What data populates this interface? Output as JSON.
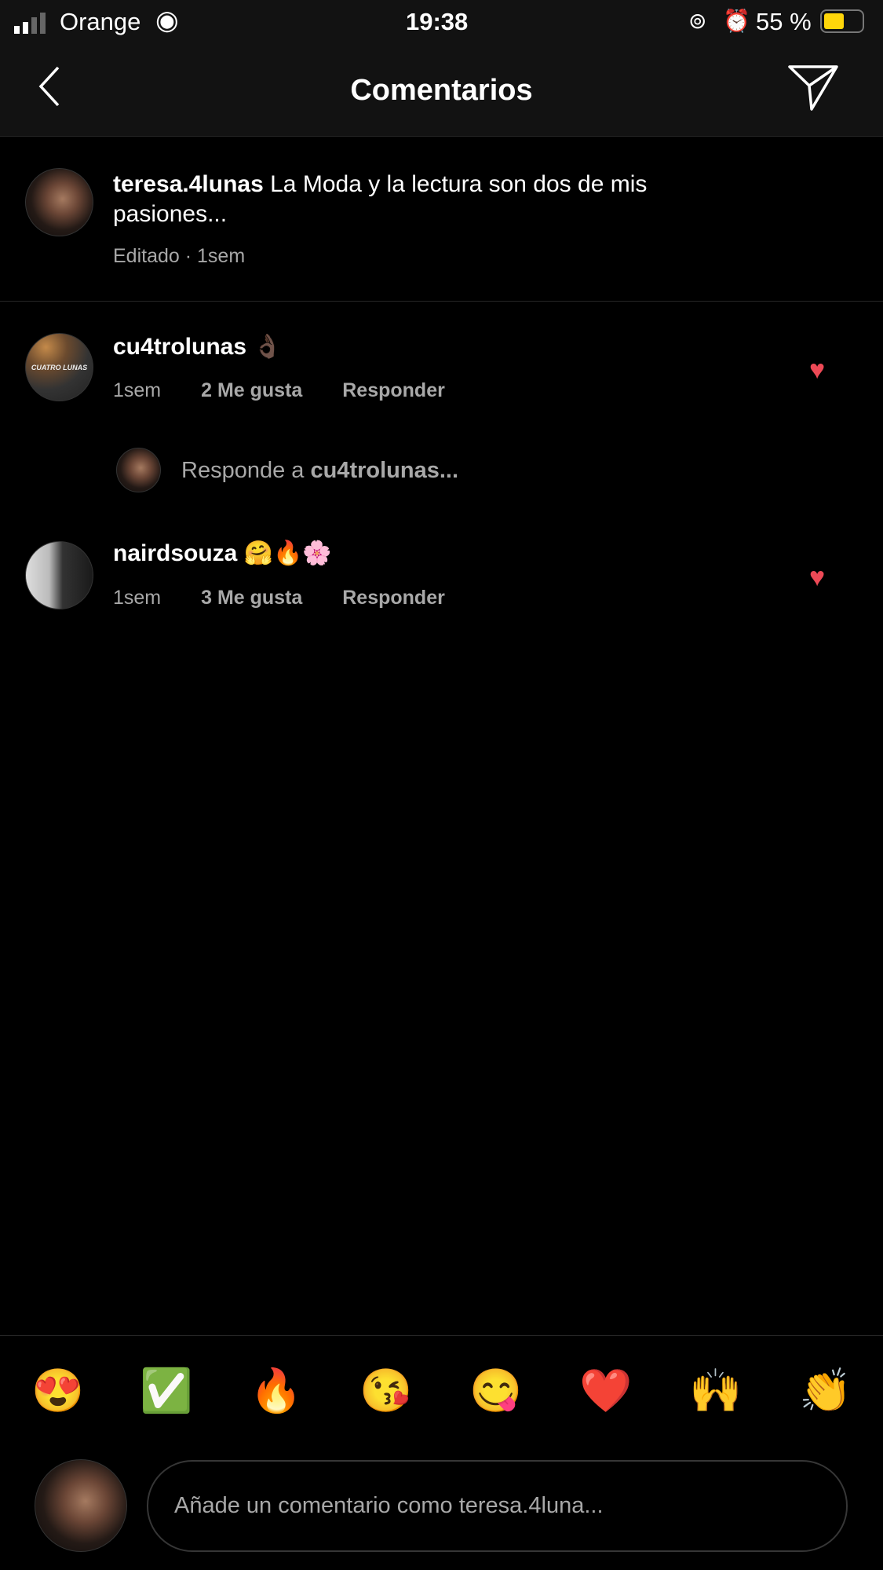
{
  "status": {
    "carrier": "Orange",
    "time": "19:38",
    "battery": "55 %",
    "battery_level": 0.55
  },
  "header": {
    "title": "Comentarios"
  },
  "caption": {
    "user": "teresa.4lunas",
    "text": "La Moda y la lectura son dos de mis",
    "text2": "pasiones...",
    "meta": "Editado · 1sem"
  },
  "comments": [
    {
      "user": "cu4trolunas",
      "text": "👌🏿",
      "time": "1sem",
      "likes": "2 Me gusta",
      "reply": "Responder",
      "avatar_text": "CUATRO LUNAS"
    },
    {
      "user": "nairdsouza",
      "text": "🤗🔥🌸",
      "time": "1sem",
      "likes": "3 Me gusta",
      "reply": "Responder"
    }
  ],
  "reply_prompt": {
    "prefix": "Responde a",
    "user": "cu4trolunas..."
  },
  "emojis": [
    "😍",
    "✅",
    "🔥",
    "😘",
    "😋",
    "❤️",
    "🙌",
    "👏"
  ],
  "input": {
    "placeholder": "Añade un comentario como teresa.4luna..."
  },
  "colors": {
    "like": "#ed4956",
    "battery": "#ffd60a"
  }
}
